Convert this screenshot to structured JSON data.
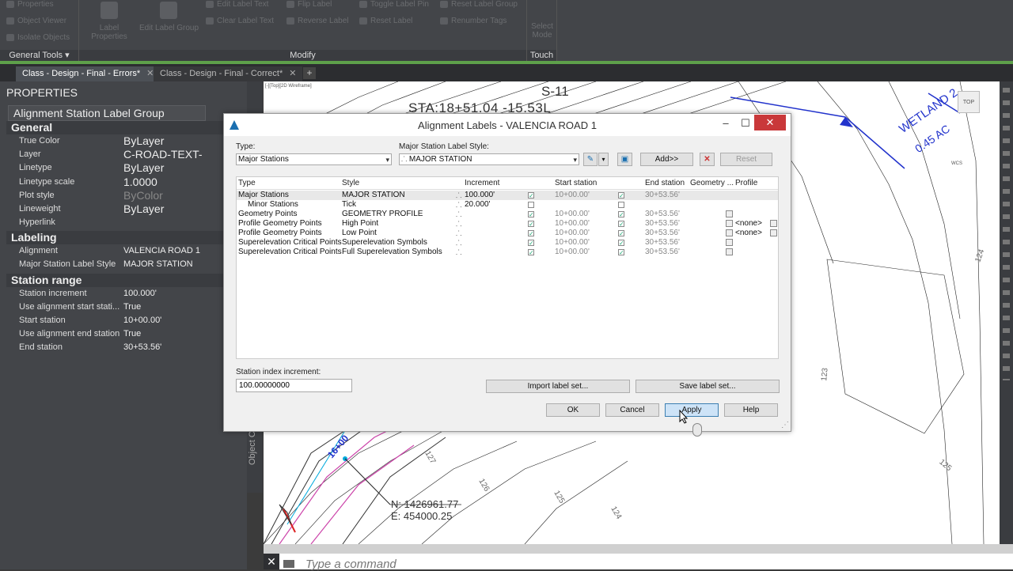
{
  "ribbon": {
    "items": [
      "Properties",
      "Object Viewer",
      "Isolate Objects",
      "Label Properties",
      "Edit Label Group",
      "Edit Label Text",
      "Clear Label Text",
      "Flip Label",
      "Reverse Label",
      "Toggle Label Pin",
      "Reset Label",
      "Reset Label Group",
      "Renumber Tags",
      "Select Mode"
    ],
    "groups": {
      "general": "General Tools",
      "modify": "Modify",
      "touch": "Touch"
    }
  },
  "tabs": [
    {
      "label": "Class - Design - Final - Errors*"
    },
    {
      "label": "Class - Design - Final - Correct*"
    }
  ],
  "properties": {
    "title": "PROPERTIES",
    "selector": "Alignment Station Label Group",
    "sections": {
      "general": "General",
      "labeling": "Labeling",
      "station": "Station range"
    },
    "general": [
      {
        "k": "True Color",
        "v": "ByLayer"
      },
      {
        "k": "Layer",
        "v": "C-ROAD-TEXT-"
      },
      {
        "k": "Linetype",
        "v": "ByLayer"
      },
      {
        "k": "Linetype scale",
        "v": "1.0000"
      },
      {
        "k": "Plot style",
        "v": "ByColor"
      },
      {
        "k": "Lineweight",
        "v": "ByLayer"
      },
      {
        "k": "Hyperlink",
        "v": ""
      }
    ],
    "labeling": [
      {
        "k": "Alignment",
        "v": "VALENCIA ROAD 1"
      },
      {
        "k": "Major Station Label Style",
        "v": "MAJOR STATION"
      }
    ],
    "station": [
      {
        "k": "Station increment",
        "v": "100.000'"
      },
      {
        "k": "Use alignment start stati...",
        "v": "True"
      },
      {
        "k": "Start station",
        "v": "10+00.00'"
      },
      {
        "k": "Use alignment end station",
        "v": "True"
      },
      {
        "k": "End station",
        "v": "30+53.56'"
      }
    ],
    "side_label": "Object Cl"
  },
  "viewport": {
    "label": "[-][Top][2D Wireframe]",
    "s_label": "S-11",
    "sta_label": "STA:18+51.04  -15.53L",
    "wetland": "WETLAND 2",
    "wetland_ac": "0.45 AC",
    "station_tag": "16+00",
    "northing": "N: 1426961.77",
    "easting": "E: 454000.25",
    "contours": [
      "124",
      "123",
      "126",
      "125",
      "124",
      "125",
      "127",
      "121"
    ],
    "viewcube": "TOP",
    "wcs": "WCS"
  },
  "command": {
    "placeholder": "Type a command"
  },
  "dialog": {
    "title": "Alignment Labels - VALENCIA ROAD 1",
    "type_label": "Type:",
    "type_value": "Major Stations",
    "style_label": "Major Station Label Style:",
    "style_value": "MAJOR STATION",
    "add_btn": "Add>>",
    "reset_btn": "Reset",
    "columns": [
      "Type",
      "Style",
      "Increment",
      "Start station",
      "End station",
      "Geometry ...",
      "Profile"
    ],
    "rows": [
      {
        "type": "Major Stations",
        "style": "MAJOR STATION",
        "inc": "100.000'",
        "s_chk": true,
        "start": "10+00.00'",
        "e_chk": true,
        "end": "30+53.56'",
        "geo": false,
        "profile": ""
      },
      {
        "type": "Minor Stations",
        "style": "Tick",
        "inc": "20.000'",
        "s_chk": false,
        "start": "",
        "e_chk": false,
        "end": "",
        "geo": false,
        "profile": ""
      },
      {
        "type": "Geometry Points",
        "style": "GEOMETRY PROFILE",
        "inc": "",
        "s_chk": true,
        "start": "10+00.00'",
        "e_chk": true,
        "end": "30+53.56'",
        "geo": true,
        "profile": ""
      },
      {
        "type": "Profile Geometry Points",
        "style": "High Point",
        "inc": "",
        "s_chk": true,
        "start": "10+00.00'",
        "e_chk": true,
        "end": "30+53.56'",
        "geo": true,
        "profile": "<none>"
      },
      {
        "type": "Profile Geometry Points",
        "style": "Low Point",
        "inc": "",
        "s_chk": true,
        "start": "10+00.00'",
        "e_chk": true,
        "end": "30+53.56'",
        "geo": true,
        "profile": "<none>"
      },
      {
        "type": "Superelevation Critical Points",
        "style": "Superelevation Symbols",
        "inc": "",
        "s_chk": true,
        "start": "10+00.00'",
        "e_chk": true,
        "end": "30+53.56'",
        "geo": true,
        "profile": ""
      },
      {
        "type": "Superelevation Critical Points",
        "style": "Full Superelevation Symbols",
        "inc": "",
        "s_chk": true,
        "start": "10+00.00'",
        "e_chk": true,
        "end": "30+53.56'",
        "geo": true,
        "profile": ""
      }
    ],
    "index_label": "Station index increment:",
    "index_value": "100.00000000",
    "import_btn": "Import label set...",
    "save_btn": "Save label set...",
    "ok_btn": "OK",
    "cancel_btn": "Cancel",
    "apply_btn": "Apply",
    "help_btn": "Help"
  },
  "colors": {
    "accent_green": "#5ea04a",
    "close_red": "#c9383a",
    "alignment_blue": "#2233cc",
    "label_magenta": "#cc44aa"
  }
}
